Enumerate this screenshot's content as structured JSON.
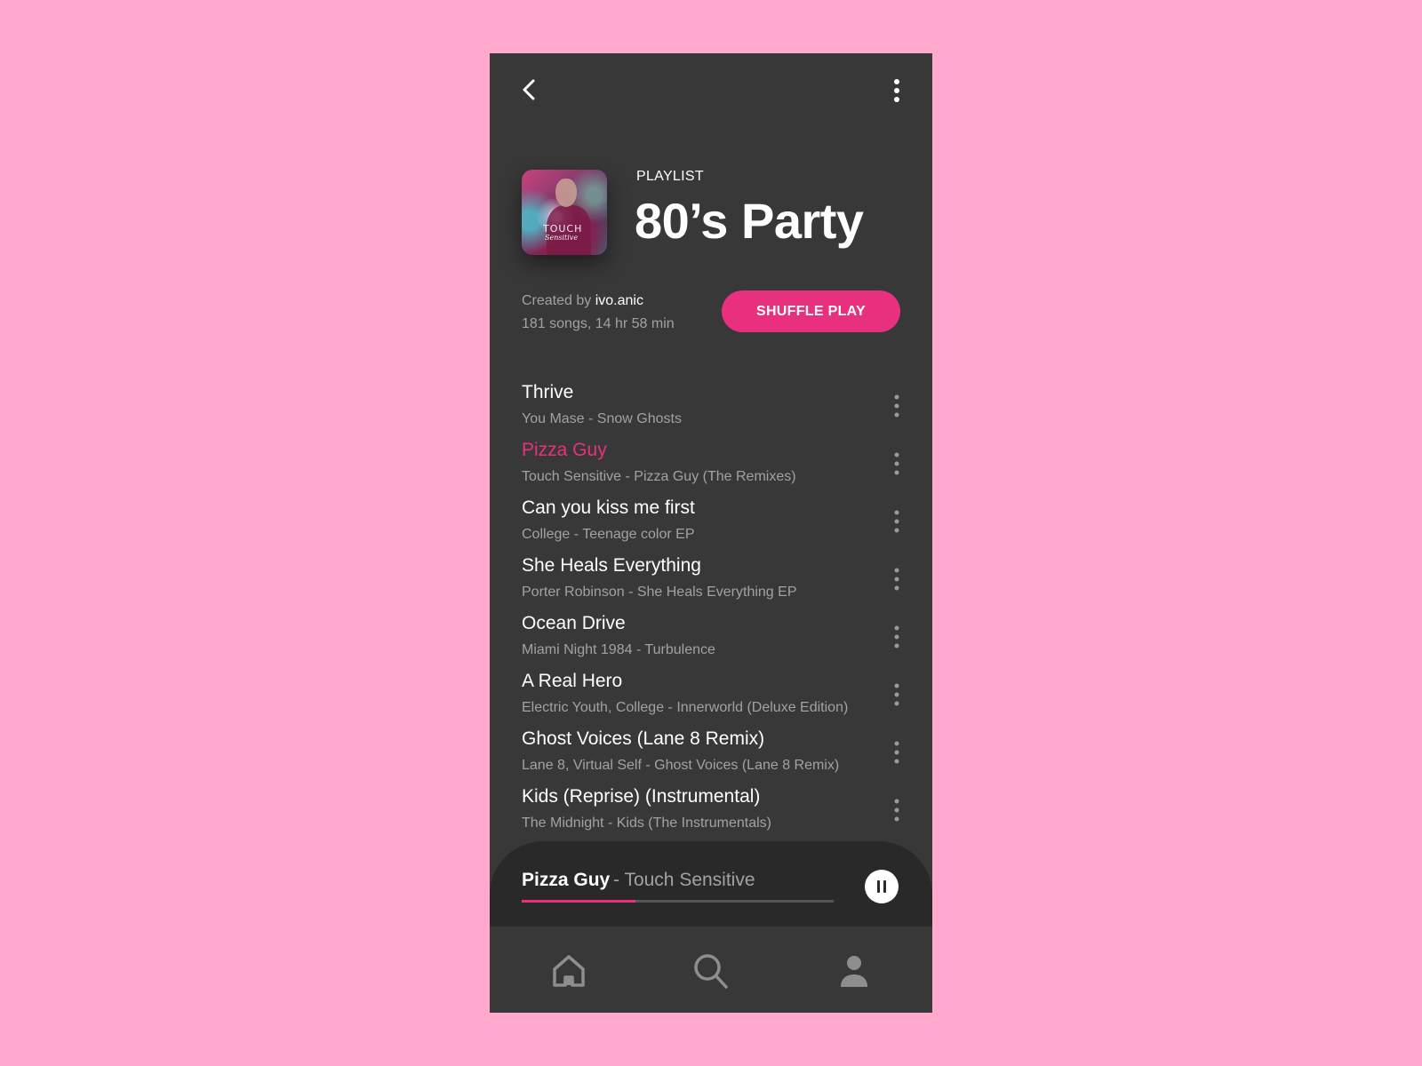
{
  "header": {
    "back_icon": "chevron-left-icon",
    "more_icon": "more-vertical-icon"
  },
  "playlist": {
    "type_label": "PLAYLIST",
    "title": "80’s Party",
    "created_by_prefix": "Created by ",
    "creator": "ivo.anic",
    "stats": "181 songs, 14 hr 58 min",
    "shuffle_label": "SHUFFLE PLAY",
    "cover_text_1": "TOUCH",
    "cover_text_2": "Sensitive"
  },
  "tracks": [
    {
      "title": "Thrive",
      "subtitle": "You Mase - Snow Ghosts",
      "active": false
    },
    {
      "title": "Pizza Guy",
      "subtitle": "Touch Sensitive - Pizza Guy (The Remixes)",
      "active": true
    },
    {
      "title": "Can you kiss me first",
      "subtitle": "College - Teenage color EP",
      "active": false
    },
    {
      "title": "She Heals Everything",
      "subtitle": "Porter Robinson - She Heals Everything EP",
      "active": false
    },
    {
      "title": "Ocean Drive",
      "subtitle": "Miami Night 1984 - Turbulence",
      "active": false
    },
    {
      "title": "A Real Hero",
      "subtitle": "Electric Youth, College - Innerworld (Deluxe Edition)",
      "active": false
    },
    {
      "title": "Ghost Voices (Lane 8 Remix)",
      "subtitle": "Lane 8, Virtual Self - Ghost Voices (Lane 8 Remix)",
      "active": false
    },
    {
      "title": "Kids (Reprise) (Instrumental)",
      "subtitle": "The Midnight - Kids (The Instrumentals)",
      "active": false
    }
  ],
  "now_playing": {
    "title": "Pizza Guy",
    "artist": "- Touch Sensitive",
    "progress_fraction": 0.365,
    "state": "playing",
    "button_icon": "pause-icon"
  },
  "nav": {
    "items": [
      {
        "name": "home",
        "icon": "home-icon"
      },
      {
        "name": "search",
        "icon": "search-icon"
      },
      {
        "name": "profile",
        "icon": "user-icon"
      }
    ]
  },
  "colors": {
    "accent": "#e8307f",
    "background": "#ffa9cf",
    "panel": "#383838",
    "player": "#292929",
    "muted_text": "#a2a2a2"
  }
}
